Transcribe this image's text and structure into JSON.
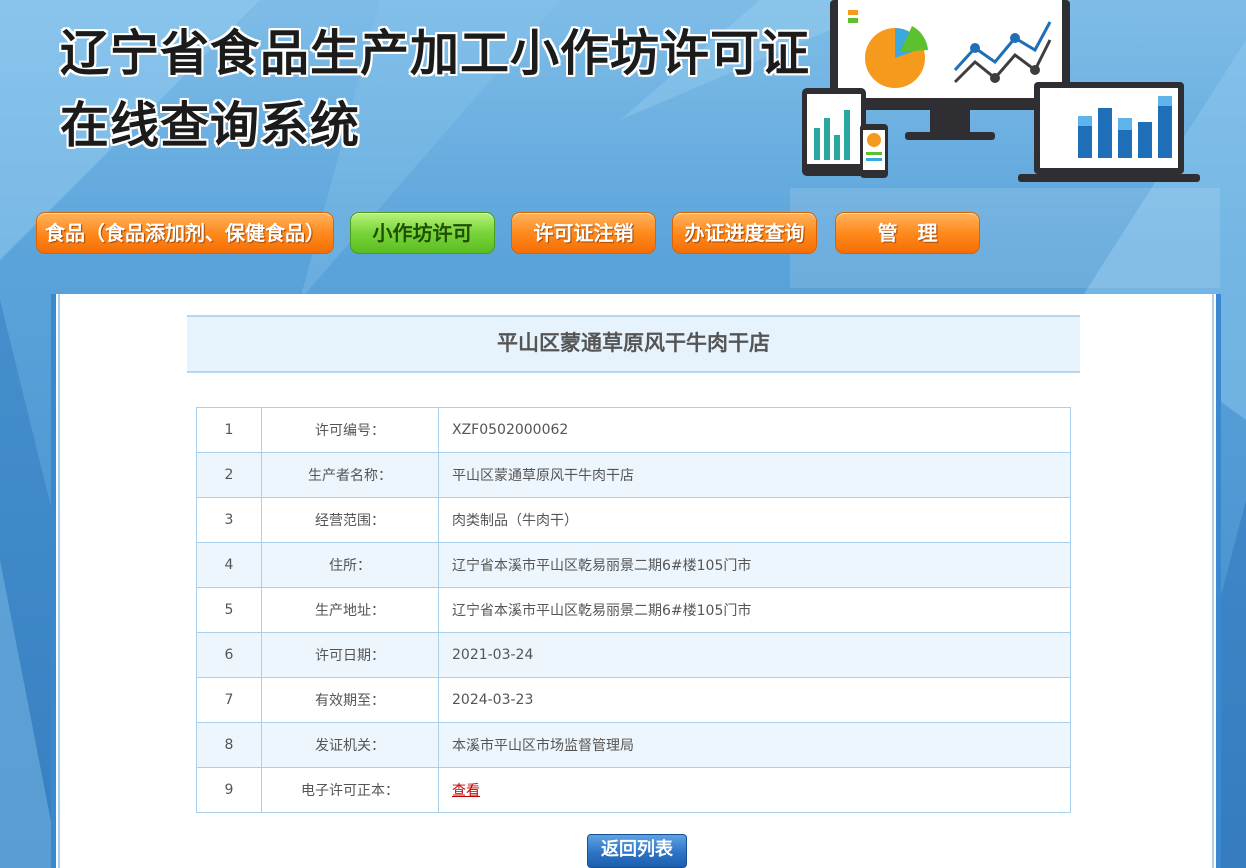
{
  "header": {
    "title_line1": "辽宁省食品生产加工小作坊许可证",
    "title_line2": "在线查询系统"
  },
  "nav": {
    "items": [
      {
        "label": "食品（食品添加剂、保健食品）",
        "active": false
      },
      {
        "label": "小作坊许可",
        "active": true
      },
      {
        "label": "许可证注销",
        "active": false
      },
      {
        "label": "办证进度查询",
        "active": false
      },
      {
        "label": "管　理",
        "active": false
      }
    ]
  },
  "shop": {
    "name": "平山区蒙通草原风干牛肉干店"
  },
  "table": {
    "rows": [
      {
        "index": "1",
        "label": "许可编号：",
        "value": "XZF0502000062"
      },
      {
        "index": "2",
        "label": "生产者名称：",
        "value": "平山区蒙通草原风干牛肉干店"
      },
      {
        "index": "3",
        "label": "经营范围：",
        "value": "肉类制品（牛肉干）"
      },
      {
        "index": "4",
        "label": "住所：",
        "value": "辽宁省本溪市平山区乾易丽景二期6#楼105门市"
      },
      {
        "index": "5",
        "label": "生产地址：",
        "value": "辽宁省本溪市平山区乾易丽景二期6#楼105门市"
      },
      {
        "index": "6",
        "label": "许可日期：",
        "value": "2021-03-24"
      },
      {
        "index": "7",
        "label": "有效期至：",
        "value": "2024-03-23"
      },
      {
        "index": "8",
        "label": "发证机关：",
        "value": "本溪市平山区市场监督管理局"
      },
      {
        "index": "9",
        "label": "电子许可正本：",
        "value": "查看"
      }
    ]
  },
  "actions": {
    "back_label": "返回列表"
  },
  "colors": {
    "nav_orange": "#f57f14",
    "nav_green": "#6cc930",
    "link_red": "#c00000",
    "border_blue": "#a9d1ee"
  }
}
